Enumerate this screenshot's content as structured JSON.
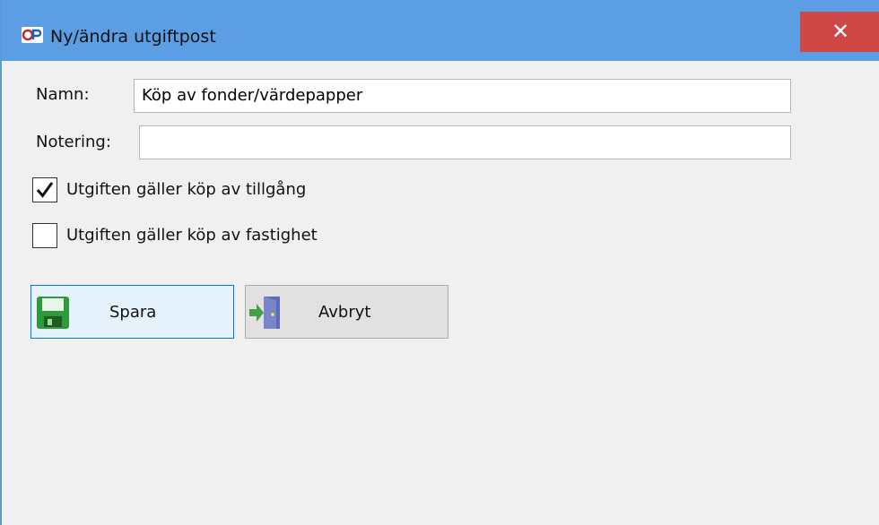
{
  "window": {
    "title": "Ny/ändra utgiftpost",
    "close_glyph": "✕",
    "icon": "app-logo-icon"
  },
  "form": {
    "name_label": "Namn:",
    "name_value": "Köp av fonder/värdepapper",
    "note_label": "Notering:",
    "note_value": ""
  },
  "checkboxes": [
    {
      "label": "Utgiften gäller köp av tillgång",
      "checked": true
    },
    {
      "label": "Utgiften gäller köp av fastighet",
      "checked": false
    }
  ],
  "buttons": {
    "save_label": "Spara",
    "save_icon": "floppy-disk-icon",
    "cancel_label": "Avbryt",
    "cancel_icon": "exit-door-icon"
  },
  "colors": {
    "titlebar": "#5b9ee3",
    "close_button": "#cf4746",
    "focus_border": "#0078d7"
  }
}
